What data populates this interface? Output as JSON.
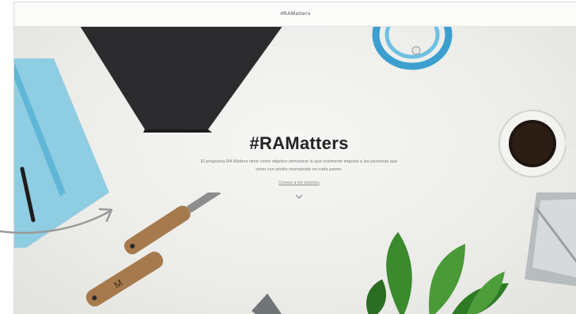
{
  "header": {
    "label": "#RAMatters"
  },
  "hero": {
    "title": "#RAMatters",
    "body": "El programa RA Matters tiene como objetivo demostrar lo que realmente importa a las personas que viven con artritis reumatoide en cada paseo.",
    "link": "Conoce a los expertos",
    "scroll_icon": "chevron-down-icon"
  },
  "colors": {
    "notebook_blue": "#8fd0e6",
    "tablet_dark": "#2c2c2e",
    "rope_blue": "#3f9dc9",
    "wood": "#a67a4c",
    "leaf": "#3c8a2e",
    "arrow": "#9a9a9a"
  }
}
